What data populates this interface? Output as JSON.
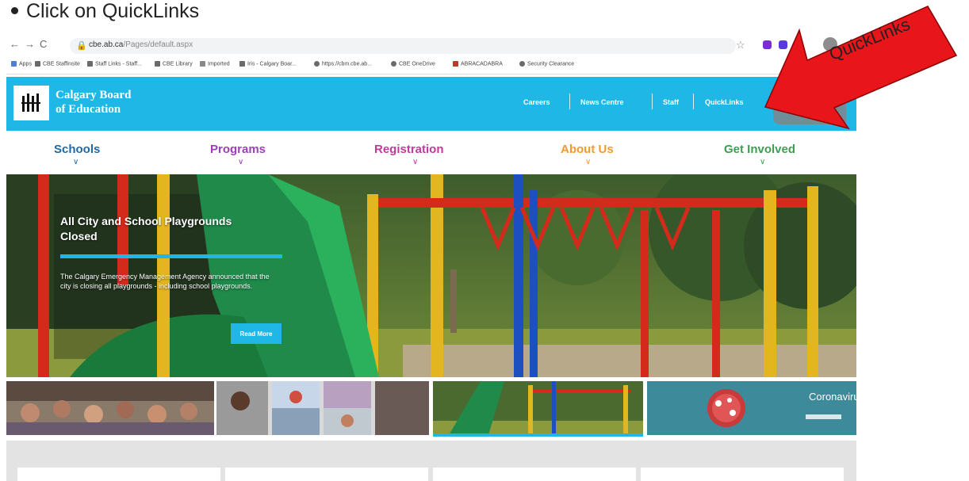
{
  "slide": {
    "instruction": "Click on QuickLinks"
  },
  "browser": {
    "url_host": "cbe.ab.ca",
    "url_path": "/Pages/default.aspx",
    "bookmarks": [
      "Apps",
      "CBE Staffinsite",
      "Staff Links - Staff...",
      "CBE Library",
      "Imported",
      "Iris - Calgary Boar...",
      "https://cbm.cbe.ab...",
      "CBE OneDrive",
      "ABRACADABRA",
      "Security Clearance"
    ]
  },
  "site": {
    "brand_line1": "Calgary Board",
    "brand_line2": "of Education",
    "top_links": [
      "Careers",
      "News Centre",
      "Staff",
      "QuickLinks"
    ],
    "nav": [
      {
        "label": "Schools",
        "color": "#1f6aa5"
      },
      {
        "label": "Programs",
        "color": "#9b3fb5"
      },
      {
        "label": "Registration",
        "color": "#c2399a"
      },
      {
        "label": "About Us",
        "color": "#f39a2e"
      },
      {
        "label": "Get Involved",
        "color": "#3e9d52"
      }
    ]
  },
  "hero": {
    "title": "All City and School Playgrounds Closed",
    "body": "The Calgary Emergency Management Agency announced that the city is closing all playgrounds - including school playgrounds.",
    "button": "Read More"
  },
  "thumbs": {
    "coronavirus": "Coronavirus"
  },
  "annotation": {
    "label": "QuickLinks"
  },
  "colors": {
    "accent": "#1eb7e6",
    "arrow": "#e8151b"
  }
}
